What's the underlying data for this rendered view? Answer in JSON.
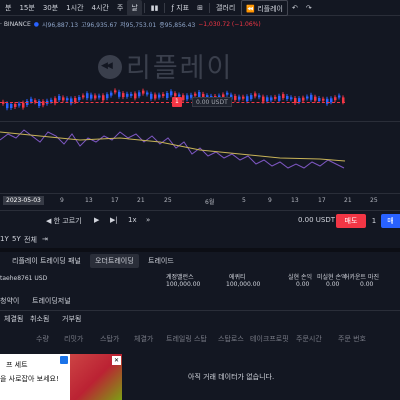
{
  "topbar": {
    "items": [
      "분",
      "15분",
      "30분",
      "1시간",
      "4시간",
      "주",
      "날"
    ],
    "indicators": "지표",
    "gallery": "갤러리",
    "replay": "리플레이"
  },
  "symbol_info": {
    "exchange": "· BINANCE",
    "open": "시96,887.13",
    "high": "고96,935.67",
    "low": "저95,753.01",
    "close": "종95,856.43",
    "change": "−1,030.72 (−1.06%)"
  },
  "watermark": "리플레이",
  "price_tag": "1",
  "price_label": "0.00 USDT",
  "time_axis": {
    "highlight": "2023-05-03",
    "ticks": [
      "9",
      "13",
      "17",
      "21",
      "25",
      "6월",
      "5",
      "9",
      "13",
      "17",
      "21",
      "25"
    ]
  },
  "replay_bar": {
    "step_label": "◀ 한 고르기",
    "speed": "1x",
    "pnl": "0.00 USDT",
    "sell": "매도",
    "qty": "1",
    "buy": "매"
  },
  "range_bar": [
    "1Y",
    "5Y",
    "전체"
  ],
  "panel": {
    "tabs": [
      "리플레이 트레이딩 패널",
      "오더트레이딩",
      "트레이드"
    ],
    "account_label": "taehe8761 USD",
    "account_cols": [
      {
        "label": "계정밸런스",
        "value": "100,000.00"
      },
      {
        "label": "에퀴티",
        "value": "100,000.00"
      },
      {
        "label": "실현 손익",
        "value": "0.00"
      },
      {
        "label": "미실현 손익",
        "value": "0.00"
      },
      {
        "label": "어카운트 마진",
        "value": "0.00"
      }
    ],
    "subtabs": [
      "청약이",
      "트레이딩저널"
    ],
    "order_tabs": [
      "체결됨",
      "취소됨",
      "거부됨"
    ],
    "columns": [
      "수량",
      "리밋가",
      "스탑가",
      "체결가",
      "트레일링 스탑",
      "스탑로스",
      "테이크프로핏",
      "주문시간",
      "주문 번호"
    ],
    "empty": "아직 거래 데이터가 없습니다.",
    "ad_line1": "프 세트",
    "ad_line2": "을 사로잡아 보세요!"
  }
}
